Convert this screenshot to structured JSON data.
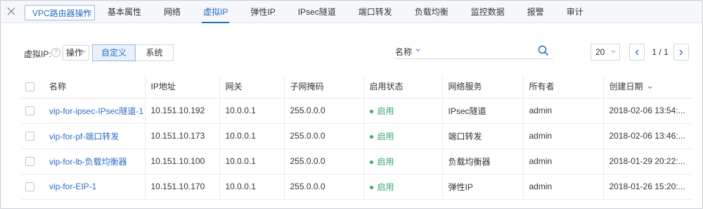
{
  "colors": {
    "accent": "#2b6cc7",
    "status_green": "#3aa56e",
    "topbar_bg": "#f5f7fa"
  },
  "topbar": {
    "close_icon": "close-icon",
    "ops_button": "VPC路由器操作",
    "tabs": [
      {
        "label": "基本属性",
        "active": false
      },
      {
        "label": "网络",
        "active": false
      },
      {
        "label": "虚拟IP",
        "active": true
      },
      {
        "label": "弹性IP",
        "active": false
      },
      {
        "label": "IPsec隧道",
        "active": false
      },
      {
        "label": "端口转发",
        "active": false
      },
      {
        "label": "负载均衡",
        "active": false
      },
      {
        "label": "监控数据",
        "active": false
      },
      {
        "label": "报警",
        "active": false
      },
      {
        "label": "审计",
        "active": false
      }
    ]
  },
  "toolbar": {
    "label": "虚拟IP:",
    "help_icon": "?",
    "action_select": "操作",
    "segments": [
      "自定义",
      "系统"
    ],
    "search_field_label": "名称",
    "page_size": "20",
    "page_indicator": "1 / 1"
  },
  "table": {
    "columns": [
      "名称",
      "IP地址",
      "网关",
      "子网掩码",
      "启用状态",
      "网络服务",
      "所有者",
      "创建日期"
    ],
    "rows": [
      {
        "name": "vip-for-ipsec-IPsec隧道-1",
        "ip": "10.151.10.192",
        "gateway": "10.0.0.1",
        "netmask": "255.0.0.0",
        "status": "启用",
        "service": "IPsec隧道",
        "owner": "admin",
        "created": "2018-02-06 13:54:..."
      },
      {
        "name": "vip-for-pf-端口转发",
        "ip": "10.151.10.173",
        "gateway": "10.0.0.1",
        "netmask": "255.0.0.0",
        "status": "启用",
        "service": "端口转发",
        "owner": "admin",
        "created": "2018-02-06 13:46:..."
      },
      {
        "name": "vip-for-lb-负载均衡器",
        "ip": "10.151.10.100",
        "gateway": "10.0.0.1",
        "netmask": "255.0.0.0",
        "status": "启用",
        "service": "负载均衡器",
        "owner": "admin",
        "created": "2018-01-29 20:22:..."
      },
      {
        "name": "vip-for-EIP-1",
        "ip": "10.151.10.170",
        "gateway": "10.0.0.1",
        "netmask": "255.0.0.0",
        "status": "启用",
        "service": "弹性IP",
        "owner": "admin",
        "created": "2018-01-26 15:20:..."
      }
    ]
  }
}
